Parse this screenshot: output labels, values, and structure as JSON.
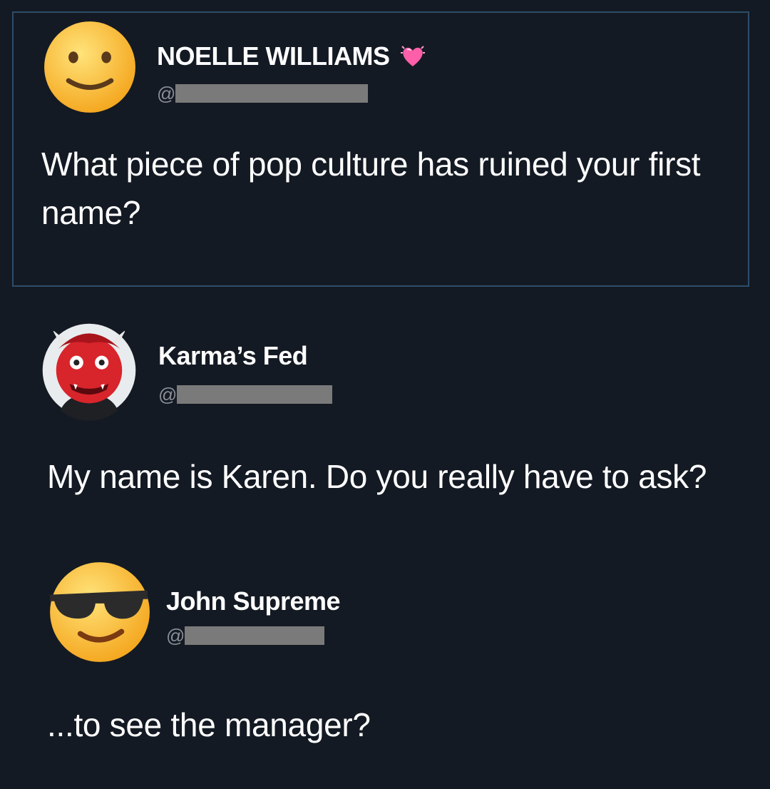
{
  "tweets": [
    {
      "author": "NOELLE WILLIAMS",
      "handle_prefix": "@",
      "handle_redacted": true,
      "badge_icon": "heart-emoji",
      "avatar_icon": "slightly-smiling-face-emoji",
      "text": "What piece of pop culture has ruined your first name?"
    },
    {
      "author": "Karma’s Fed",
      "handle_prefix": "@",
      "handle_redacted": true,
      "avatar_icon": "ogre-emoji",
      "text": "My name is Karen. Do you really have to ask?"
    },
    {
      "author": "John Supreme",
      "handle_prefix": "@",
      "handle_redacted": true,
      "avatar_icon": "sunglasses-face-emoji",
      "text": "...to see the manager?"
    }
  ],
  "colors": {
    "background": "#141a23",
    "frame_border": "#2d4d6a",
    "redaction": "#7a7a7a",
    "text": "#ffffff"
  }
}
